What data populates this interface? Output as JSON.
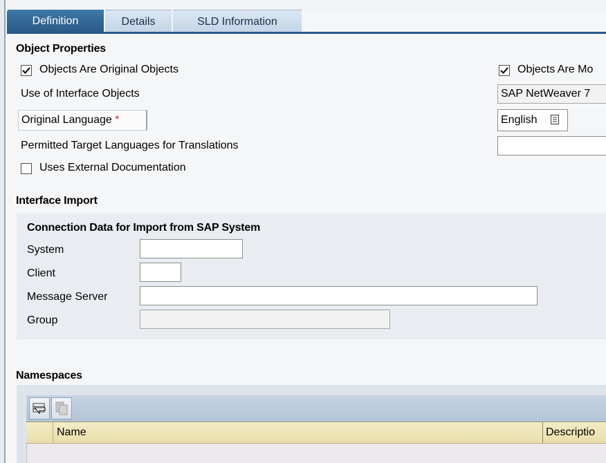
{
  "tabs": [
    {
      "label": "Definition",
      "active": true
    },
    {
      "label": "Details",
      "active": false
    },
    {
      "label": "SLD Information",
      "active": false
    }
  ],
  "object_properties": {
    "heading": "Object Properties",
    "original_objects": {
      "label": "Objects Are Original Objects",
      "checked": true
    },
    "modifiable": {
      "label": "Objects Are Mo",
      "checked": true
    },
    "use_interface_objects": {
      "label": "Use of Interface Objects",
      "value": "SAP NetWeaver 7"
    },
    "original_language": {
      "label": "Original Language",
      "required_marker": "*",
      "value": "English"
    },
    "permitted_target": {
      "label": "Permitted Target Languages for Translations",
      "value": ""
    },
    "external_doc": {
      "label": "Uses External Documentation",
      "checked": false
    }
  },
  "interface_import": {
    "heading": "Interface Import",
    "subheading": "Connection Data for Import from SAP System",
    "fields": {
      "system": {
        "label": "System",
        "value": ""
      },
      "client": {
        "label": "Client",
        "value": ""
      },
      "message_server": {
        "label": "Message Server",
        "value": ""
      },
      "group": {
        "label": "Group",
        "value": ""
      }
    }
  },
  "namespaces": {
    "heading": "Namespaces",
    "toolbar": {
      "insert_icon": "insert-row-icon",
      "copy_icon": "copy-icon"
    },
    "columns": [
      "Name",
      "Descriptio"
    ]
  },
  "colors": {
    "tab_active": "#295a87",
    "tab_inactive": "#c3d4e7",
    "table_header": "#ede4b7",
    "required": "#c0392b"
  }
}
